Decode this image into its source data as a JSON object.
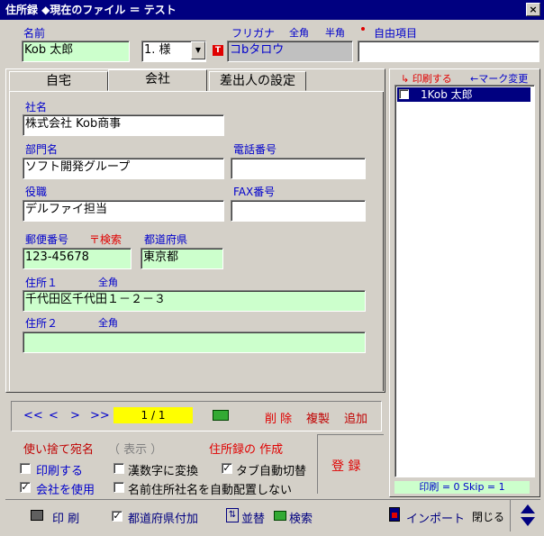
{
  "window": {
    "title": "住所録 ◆現在のファイル ＝ テスト",
    "close": "×"
  },
  "header": {
    "name_label": "名前",
    "name_value": "Kob 太郎",
    "honorific": "1. 様",
    "furigana_label": "フリガナ",
    "zenkaku": "全角",
    "hankaku": "半角",
    "free_item_label": "自由項目",
    "furigana_value": "コbタロウ",
    "furigana_icon": "T",
    "free_item_value": ""
  },
  "tabs": [
    {
      "label": "自宅"
    },
    {
      "label": "会社"
    },
    {
      "label": "差出人の設定"
    }
  ],
  "company": {
    "company_name_label": "社名",
    "company_name_value": "株式会社 Kob商事",
    "dept_label": "部門名",
    "dept_value": "ソフト開発グループ",
    "phone_label": "電話番号",
    "phone_value": "",
    "title_label": "役職",
    "title_value": "デルファイ担当",
    "fax_label": "FAX番号",
    "fax_value": "",
    "zip_label": "郵便番号",
    "zip_search": "〒検索",
    "pref_label": "都道府県",
    "zip_value": "123-45678",
    "pref_value": "東京都",
    "addr1_label": "住所１",
    "addr1_zenkaku": "全角",
    "addr1_value": "千代田区千代田１－２－３",
    "addr2_label": "住所２",
    "addr2_zenkaku": "全角",
    "addr2_value": ""
  },
  "nav": {
    "first": "<<",
    "prev": "<",
    "next": ">",
    "last": ">>",
    "page": "1 / 1",
    "delete": "削 除",
    "copy": "複製",
    "add": "追加"
  },
  "options": {
    "disposable_label": "使い捨て宛名",
    "display_label": "（ 表示 ）",
    "create_label": "住所録の 作成",
    "print_label": "印刷する",
    "kanji_label": "漢数字に変換",
    "tab_auto_label": "タブ自動切替",
    "use_company_label": "会社を使用",
    "no_auto_place_label": "名前住所社名を自動配置しない",
    "register": "登 録"
  },
  "list_panel": {
    "print_label": "印刷する",
    "mark_change": "←マーク変更",
    "items": [
      {
        "label": "1Kob 太郎"
      }
    ],
    "status": "印刷 = 0  Skip = 1"
  },
  "bottom": {
    "print": "印 刷",
    "pref_attach": "都道府県付加",
    "sort": "並替",
    "search": "検索",
    "import": "インポート",
    "close": "閉じる"
  }
}
